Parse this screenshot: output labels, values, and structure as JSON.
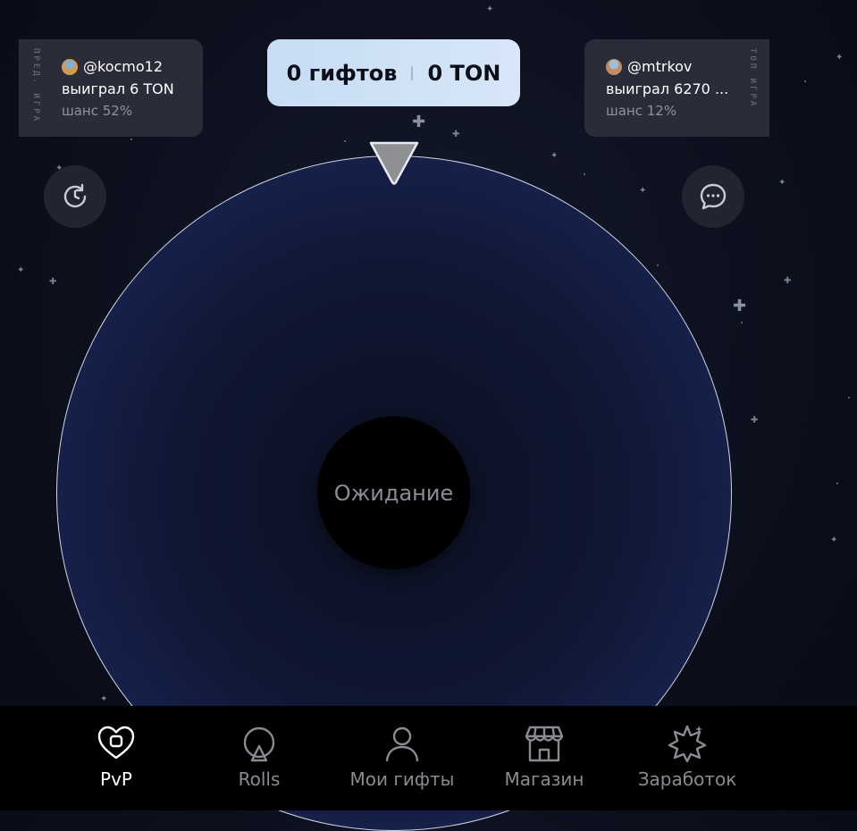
{
  "pot": {
    "gifts": "0 гифтов",
    "ton": "0 TON"
  },
  "prev_game": {
    "label": "ПРЕД. ИГРА",
    "username": "@kocmo12",
    "won": "выиграл 6 TON",
    "chance": "шанс 52%"
  },
  "top_game": {
    "label": "ТОП ИГРА",
    "username": "@mtrkov",
    "won": "выиграл 6270 ...",
    "chance": "шанс 12%"
  },
  "wheel": {
    "status": "Ожидание"
  },
  "tabs": [
    {
      "label": "PvP",
      "icon": "heart-icon",
      "active": true
    },
    {
      "label": "Rolls",
      "icon": "rolls-icon",
      "active": false
    },
    {
      "label": "Мои гифты",
      "icon": "user-icon",
      "active": false
    },
    {
      "label": "Магазин",
      "icon": "shop-icon",
      "active": false
    },
    {
      "label": "Заработок",
      "icon": "star-burst-icon",
      "active": false
    }
  ],
  "colors": {
    "background": "#0c0f1c",
    "pot_bg": "#cfe2f6",
    "card_bg": "#2a2d39",
    "wheel_fill": "#16204a",
    "tab_active": "#ffffff",
    "tab_inactive": "#8a8b91"
  }
}
